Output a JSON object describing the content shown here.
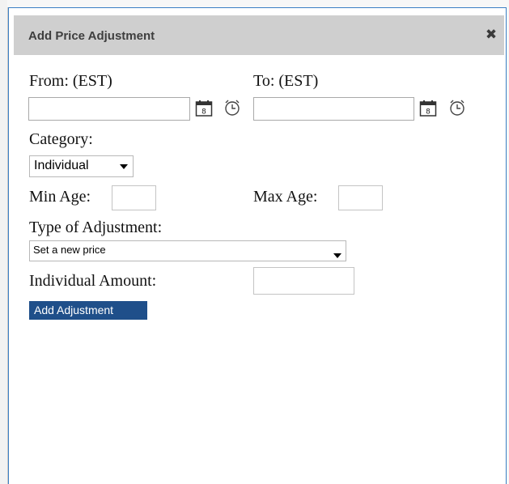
{
  "dialog": {
    "title": "Add Price Adjustment",
    "close_icon": "close-icon"
  },
  "form": {
    "from_label": "From: (EST)",
    "from_value": "",
    "to_label": "To: (EST)",
    "to_value": "",
    "category_label": "Category:",
    "category_selected": "Individual",
    "min_age_label": "Min Age:",
    "min_age_value": "",
    "max_age_label": "Max Age:",
    "max_age_value": "",
    "adjustment_type_label": "Type of Adjustment:",
    "adjustment_type_selected": "Set a new price",
    "amount_label": "Individual Amount:",
    "amount_value": "",
    "submit_label": "Add Adjustment"
  },
  "icons": {
    "calendar": "calendar-icon",
    "clock": "clock-icon",
    "dropdown": "chevron-down-icon"
  },
  "colors": {
    "titlebar": "#cfcfcf",
    "button": "#1f4f8a",
    "border": "#3b7fc4"
  }
}
